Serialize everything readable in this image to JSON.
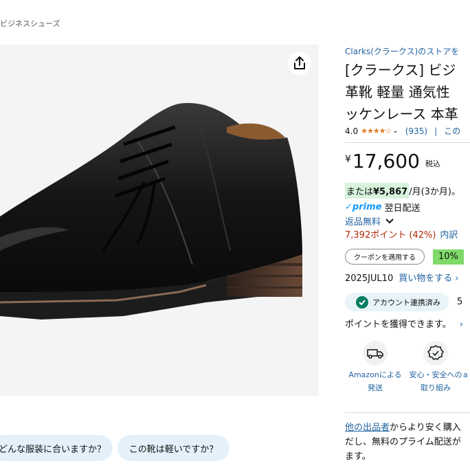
{
  "breadcrumb": "ビジネスシューズ",
  "product": {
    "store_link": "Clarks(クラークス)のストアを",
    "title_lines": [
      "[クラークス] ビジ",
      "革靴 軽量 通気性",
      "ッケンレース 本革"
    ],
    "rating_value": "4.0",
    "rating_stars": 4,
    "review_count": "(935)",
    "rating_sep": "|",
    "rating_more": "この",
    "price_currency": "¥",
    "price": "17,600",
    "tax_label": "税込",
    "installment_prefix": "または",
    "installment_amount": "¥5,867",
    "installment_suffix": "/月(3か月)。",
    "prime_label": "prime",
    "prime_delivery": "翌日配送",
    "returns_label": "返品無料",
    "points_text": "7,392ポイント (42%)",
    "points_details": "内訳",
    "coupon_button": "クーポンを適用する",
    "coupon_percent": "10%",
    "date_text": "2025JUL10",
    "buy_link": "買い物をする ›",
    "account_badge": "アカウント連携済み",
    "account_number": "5",
    "earn_points": "ポイントを獲得できます。",
    "earn_chevron": "›",
    "features": [
      {
        "icon": "delivery-van-icon",
        "line1": "Amazonによる",
        "line2": "発送"
      },
      {
        "icon": "secure-badge-icon",
        "line1": "安心・安全への",
        "line2": "取り組み"
      },
      {
        "icon": "extra-icon",
        "line1": "a",
        "line2": ""
      }
    ],
    "offer_link": "他の出品者",
    "offer_line1_rest": "からより安く購入",
    "offer_line2": "だし、無料のプライム配送が",
    "offer_line3": "ます。"
  },
  "chips": [
    {
      "label": "どんな服装に合いますか？"
    },
    {
      "label": "この靴は軽いですか？"
    }
  ],
  "colors": {
    "link": "#2162a1",
    "price_red": "#b12704",
    "star": "#de7921",
    "chip_bg": "#e4f1fa",
    "install_bg": "#d8f3dc",
    "coupon_green": "#7fda69"
  }
}
